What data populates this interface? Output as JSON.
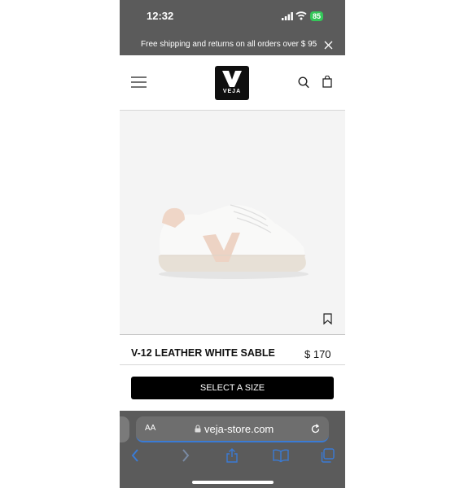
{
  "status_bar": {
    "time": "12:32",
    "battery": "85"
  },
  "promo": {
    "text": "Free shipping and returns on all orders over $ 95"
  },
  "header": {
    "logo_text": "VEJA"
  },
  "product": {
    "name": "V-12 LEATHER WHITE SABLE",
    "price": "$ 170",
    "cta": "SELECT A SIZE"
  },
  "browser": {
    "text_size_label": "AA",
    "url": "veja-store.com"
  },
  "colors": {
    "chrome": "#5b5b5b",
    "accent_blue": "#3a7bd5",
    "battery_green": "#34c759",
    "button_black": "#000000"
  },
  "icons": [
    "signal-icon",
    "wifi-icon",
    "close-icon",
    "menu-icon",
    "search-icon",
    "bag-icon",
    "bookmark-icon",
    "lock-icon",
    "reload-icon",
    "back-icon",
    "forward-icon",
    "share-icon",
    "bookmarks-icon",
    "tabs-icon"
  ]
}
